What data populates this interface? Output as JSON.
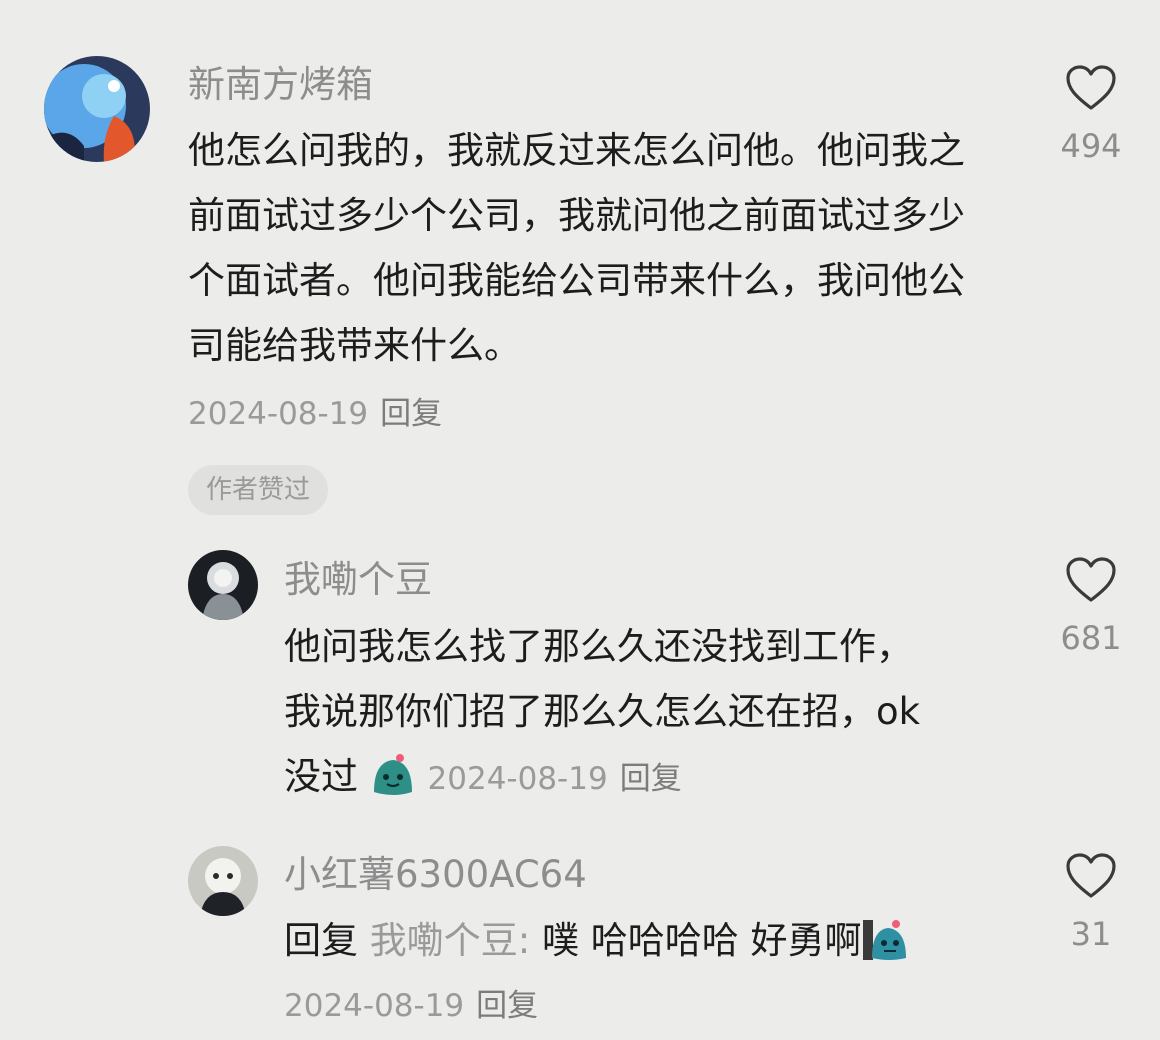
{
  "comments": [
    {
      "username": "新南方烤箱",
      "text": "他怎么问我的，我就反过来怎么问他。他问我之前面试过多少个公司，我就问他之前面试过多少个面试者。他问我能给公司带来什么，我问他公司能给我带来什么。",
      "date": "2024-08-19",
      "reply_label": "回复",
      "likes": "494",
      "author_badge": "作者赞过"
    },
    {
      "username": "我嘞个豆",
      "text_lines": [
        "他问我怎么找了那么久还没找到工作，",
        "我说那你们招了那么久怎么还在招，ok",
        "没过"
      ],
      "emoji_icon": "smile-emoji-icon",
      "date": "2024-08-19",
      "reply_label": "回复",
      "likes": "681"
    },
    {
      "username": "小红薯6300AC64",
      "reply_prefix": "回复",
      "reply_target": "我嘞个豆:",
      "text": "噗 哈哈哈哈 好勇啊",
      "emoji_icon": "peek-emoji-icon",
      "date": "2024-08-19",
      "reply_label": "回复",
      "likes": "31"
    }
  ],
  "colors": {
    "background": "#ececea",
    "text": "#1d1d1d",
    "muted": "#8d8d8d",
    "badge_bg": "#e0e0de"
  },
  "icons": [
    "heart-outline-icon",
    "avatar-image"
  ]
}
